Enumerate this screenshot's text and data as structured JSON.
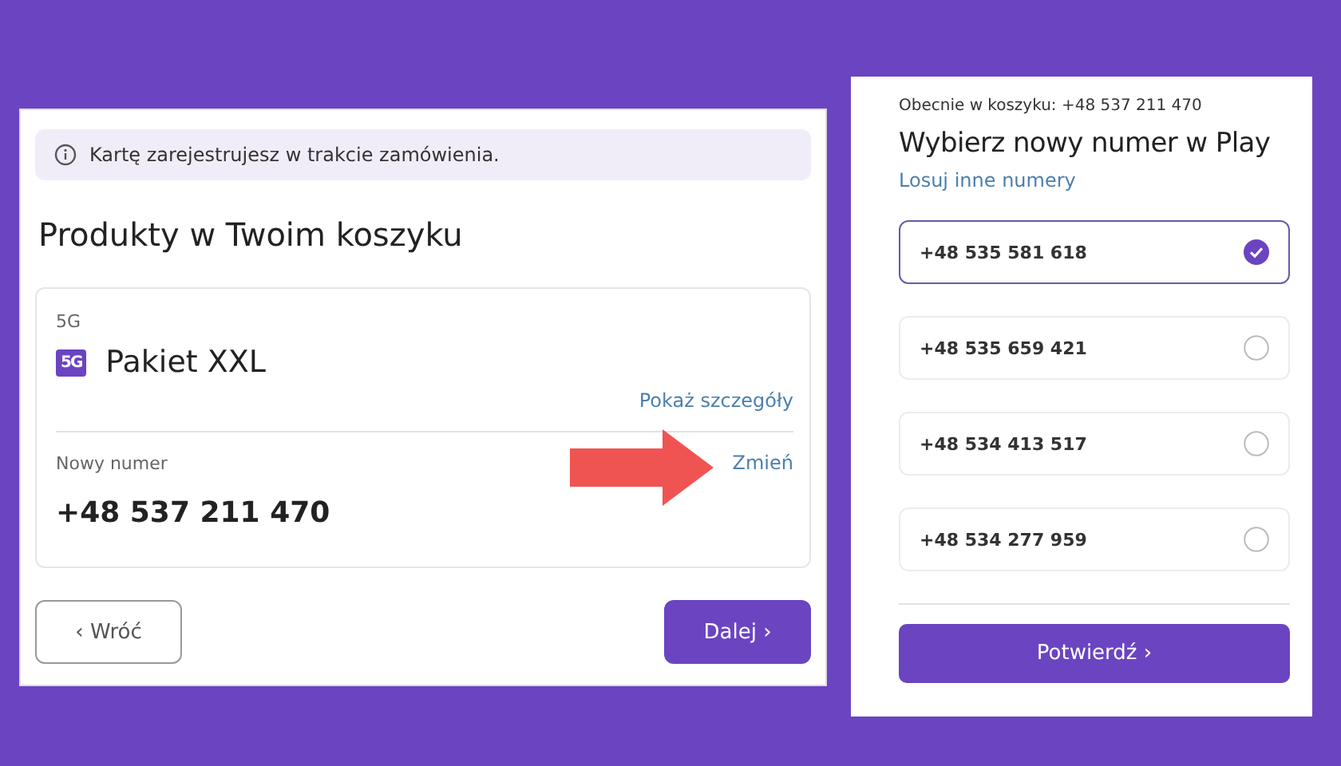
{
  "cart_panel": {
    "notice": "Kartę zarejestrujesz w trakcie zamówienia.",
    "title": "Produkty w Twoim koszyku",
    "product": {
      "category": "5G",
      "badge": "5G",
      "name": "Pakiet XXL",
      "details_link": "Pokaż szczegóły"
    },
    "number": {
      "label": "Nowy numer",
      "change_link": "Zmień",
      "value": "+48 537 211 470"
    },
    "buttons": [
      {
        "label": "‹ Wróć",
        "kind": "secondary"
      },
      {
        "label": "Dalej ›",
        "kind": "primary"
      }
    ]
  },
  "number_panel": {
    "current": "Obecnie w koszyku: +48 537 211 470",
    "title": "Wybierz nowy numer w Play",
    "shuffle_link": "Losuj inne numery",
    "options": [
      {
        "number": "+48 535 581 618",
        "selected": true
      },
      {
        "number": "+48 535 659 421",
        "selected": false
      },
      {
        "number": "+48 534 413 517",
        "selected": false
      },
      {
        "number": "+48 534 277 959",
        "selected": false
      }
    ],
    "confirm_button": "Potwierdź ›"
  }
}
